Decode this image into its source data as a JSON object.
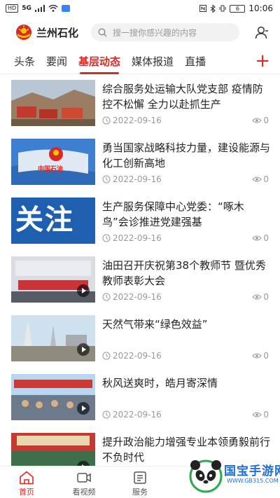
{
  "status_bar": {
    "network_tag": "HD",
    "signal_5g": "5G",
    "time": "10:06",
    "battery": "6"
  },
  "header": {
    "brand": "兰州石化",
    "search_placeholder": "搜一搜你感兴趣的内容"
  },
  "tabs": [
    {
      "label": "头条"
    },
    {
      "label": "要闻"
    },
    {
      "label": "基层动态",
      "active": true
    },
    {
      "label": "媒体报道"
    },
    {
      "label": "直播"
    }
  ],
  "news": [
    {
      "title": "综合服务处运输大队党支部 疫情防控不松懈 全力以赴抓生产",
      "date": "2022-09-16",
      "views": "0",
      "video": false
    },
    {
      "title": "勇当国家战略科技力量，建设能源与化工创新高地",
      "date": "2022-09-16",
      "views": "0",
      "video": false,
      "image_text": "中国石油"
    },
    {
      "title": "生产服务保障中心党委：“啄木鸟”会诊推进党建强基",
      "date": "2022-09-16",
      "views": "0",
      "video": false,
      "image_text": "关注"
    },
    {
      "title": "油田召开庆祝第38个教师节 暨优秀教师表彰大会",
      "date": "2022-09-16",
      "views": "0",
      "video": true
    },
    {
      "title": "天然气带来“绿色效益”",
      "date": "2022-09-16",
      "views": "0",
      "video": true
    },
    {
      "title": "秋风送爽时，皓月寄深情",
      "date": "2022-09-16",
      "views": "0",
      "video": true
    },
    {
      "title": "提升政治能力增强专业本领勇毅前行不负时代",
      "date": "",
      "views": "",
      "video": true
    }
  ],
  "bottom_nav": [
    {
      "label": "首页",
      "icon": "home-icon",
      "active": true
    },
    {
      "label": "看视频",
      "icon": "video-icon"
    },
    {
      "label": "服务",
      "icon": "service-icon"
    }
  ],
  "watermark": {
    "text": "国宝手游网",
    "url": "WWW.GB315.COM"
  },
  "colors": {
    "accent": "#d62a26",
    "muted": "#999999"
  }
}
